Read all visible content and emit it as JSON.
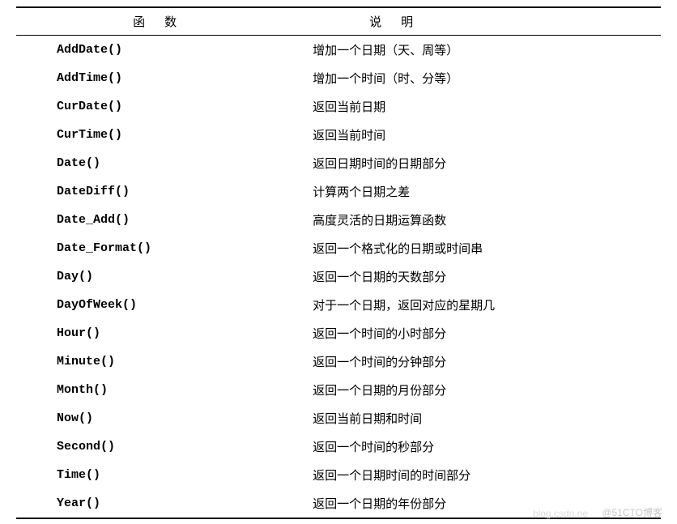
{
  "headers": {
    "function": "函数",
    "description": "说明"
  },
  "rows": [
    {
      "func": "AddDate()",
      "desc": "增加一个日期（天、周等）"
    },
    {
      "func": "AddTime()",
      "desc": "增加一个时间（时、分等）"
    },
    {
      "func": "CurDate()",
      "desc": "返回当前日期"
    },
    {
      "func": "CurTime()",
      "desc": "返回当前时间"
    },
    {
      "func": "Date()",
      "desc": "返回日期时间的日期部分"
    },
    {
      "func": "DateDiff()",
      "desc": "计算两个日期之差"
    },
    {
      "func": "Date_Add()",
      "desc": "高度灵活的日期运算函数"
    },
    {
      "func": "Date_Format()",
      "desc": "返回一个格式化的日期或时间串"
    },
    {
      "func": "Day()",
      "desc": "返回一个日期的天数部分"
    },
    {
      "func": "DayOfWeek()",
      "desc": "对于一个日期，返回对应的星期几"
    },
    {
      "func": "Hour()",
      "desc": "返回一个时间的小时部分"
    },
    {
      "func": "Minute()",
      "desc": "返回一个时间的分钟部分"
    },
    {
      "func": "Month()",
      "desc": "返回一个日期的月份部分"
    },
    {
      "func": "Now()",
      "desc": "返回当前日期和时间"
    },
    {
      "func": "Second()",
      "desc": "返回一个时间的秒部分"
    },
    {
      "func": "Time()",
      "desc": "返回一个日期时间的时间部分"
    },
    {
      "func": "Year()",
      "desc": "返回一个日期的年份部分"
    }
  ],
  "watermark": "@51CTO博客",
  "watermark2": "blog.csdn.ne"
}
